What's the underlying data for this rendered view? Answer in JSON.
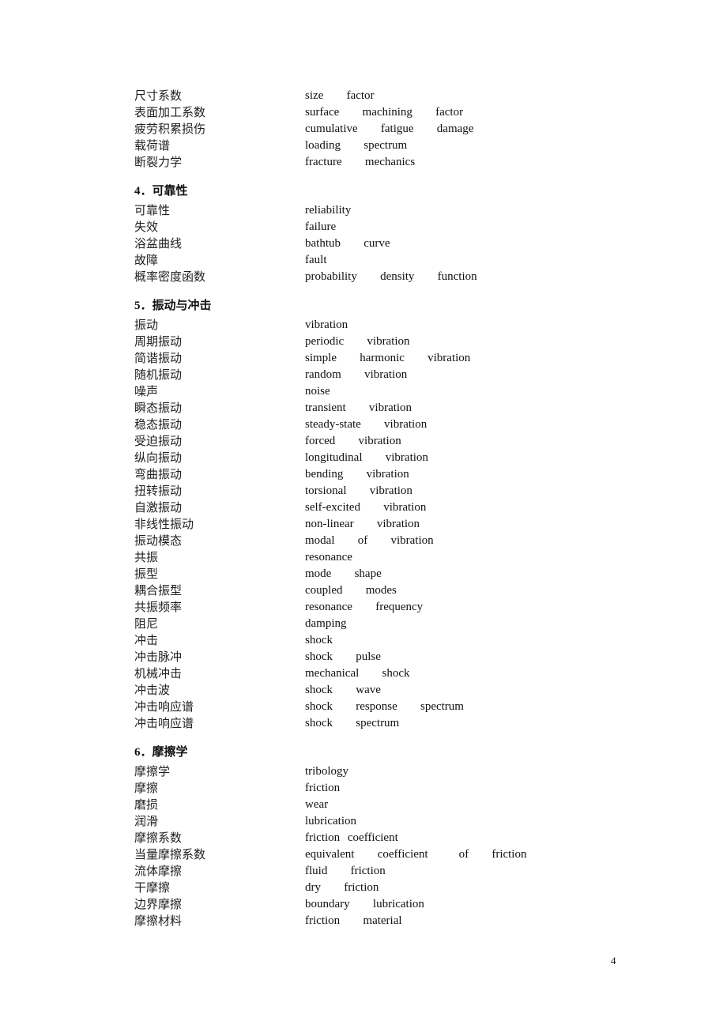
{
  "page_number": "4",
  "sections": [
    {
      "heading_number": "",
      "heading_title": "",
      "entries": [
        {
          "zh": "尺寸系数",
          "en": "size   factor"
        },
        {
          "zh": "表面加工系数",
          "en": "surface   machining   factor"
        },
        {
          "zh": "疲劳积累损伤",
          "en": "cumulative   fatigue   damage"
        },
        {
          "zh": "载荷谱",
          "en": "loading   spectrum"
        },
        {
          "zh": "断裂力学",
          "en": "fracture   mechanics"
        }
      ]
    },
    {
      "heading_number": "4．",
      "heading_title": "可靠性",
      "entries": [
        {
          "zh": "可靠性",
          "en": "reliability"
        },
        {
          "zh": "失效",
          "en": "failure"
        },
        {
          "zh": "浴盆曲线",
          "en": "bathtub   curve"
        },
        {
          "zh": "故障",
          "en": "fault"
        },
        {
          "zh": "概率密度函数",
          "en": "probability   density   function"
        }
      ]
    },
    {
      "heading_number": "5．",
      "heading_title": "振动与冲击",
      "entries": [
        {
          "zh": "振动",
          "en": "vibration"
        },
        {
          "zh": "周期振动",
          "en": "periodic   vibration"
        },
        {
          "zh": "简谐振动",
          "en": "simple   harmonic   vibration"
        },
        {
          "zh": "随机振动",
          "en": "random   vibration"
        },
        {
          "zh": "噪声",
          "en": "noise"
        },
        {
          "zh": "瞬态振动",
          "en": "transient   vibration"
        },
        {
          "zh": "稳态振动",
          "en": "steady-state   vibration"
        },
        {
          "zh": "受迫振动",
          "en": "forced   vibration"
        },
        {
          "zh": "纵向振动",
          "en": "longitudinal   vibration"
        },
        {
          "zh": "弯曲振动",
          "en": "bending   vibration"
        },
        {
          "zh": "扭转振动",
          "en": "torsional   vibration"
        },
        {
          "zh": "自激振动",
          "en": "self-excited   vibration"
        },
        {
          "zh": "非线性振动",
          "en": "non-linear   vibration"
        },
        {
          "zh": "振动模态",
          "en": "modal   of   vibration"
        },
        {
          "zh": "共振",
          "en": "resonance"
        },
        {
          "zh": "振型",
          "en": "mode   shape"
        },
        {
          "zh": "耦合振型",
          "en": "coupled   modes"
        },
        {
          "zh": "共振频率",
          "en": "resonance   frequency"
        },
        {
          "zh": "阻尼",
          "en": "damping"
        },
        {
          "zh": "冲击",
          "en": "shock"
        },
        {
          "zh": "冲击脉冲",
          "en": "shock   pulse"
        },
        {
          "zh": "机械冲击",
          "en": "mechanical   shock"
        },
        {
          "zh": "冲击波",
          "en": "shock   wave"
        },
        {
          "zh": "冲击响应谱",
          "en": "shock   response   spectrum"
        },
        {
          "zh": "冲击响应谱",
          "en": "shock   spectrum"
        }
      ]
    },
    {
      "heading_number": "6．",
      "heading_title": "摩擦学",
      "entries": [
        {
          "zh": "摩擦学",
          "en": "tribology"
        },
        {
          "zh": "摩擦",
          "en": "friction"
        },
        {
          "zh": "磨损",
          "en": "wear"
        },
        {
          "zh": "润滑",
          "en": "lubrication"
        },
        {
          "zh": "摩擦系数",
          "en": "friction coefficient"
        },
        {
          "zh": "当量摩擦系数",
          "en": "equivalent   coefficient    of   friction"
        },
        {
          "zh": "流体摩擦",
          "en": "fluid   friction"
        },
        {
          "zh": "干摩擦",
          "en": "dry   friction"
        },
        {
          "zh": "边界摩擦",
          "en": "boundary   lubrication"
        },
        {
          "zh": "摩擦材料",
          "en": "friction   material"
        }
      ]
    }
  ]
}
